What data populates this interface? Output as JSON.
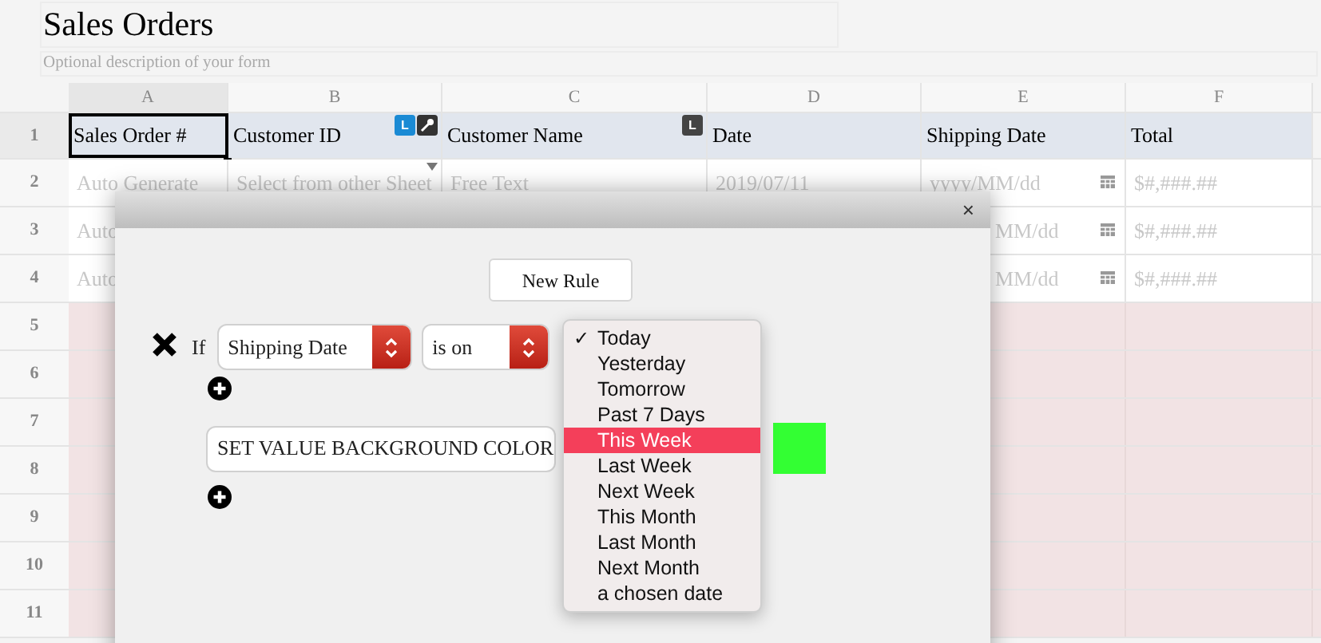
{
  "form": {
    "title": "Sales Orders",
    "description": "Optional description of your form"
  },
  "sheet": {
    "columns": [
      {
        "label": "A",
        "selected": true
      },
      {
        "label": "B",
        "selected": false
      },
      {
        "label": "C",
        "selected": false
      },
      {
        "label": "D",
        "selected": false
      },
      {
        "label": "E",
        "selected": false
      },
      {
        "label": "F",
        "selected": false
      }
    ],
    "rows": [
      {
        "number": "1",
        "kind": "header",
        "cells": [
          {
            "text": "Sales Order #",
            "selected": true
          },
          {
            "text": "Customer ID",
            "selected": false,
            "badges": [
              {
                "kind": "letter",
                "text": "L",
                "color": "#1a8ad4"
              },
              {
                "kind": "key",
                "color": "#333333"
              }
            ]
          },
          {
            "text": "Customer Name",
            "selected": false,
            "badges": [
              {
                "kind": "letter",
                "text": "L",
                "color": "#444444"
              }
            ]
          },
          {
            "text": "Date",
            "selected": false
          },
          {
            "text": "Shipping Date",
            "selected": false
          },
          {
            "text": "Total",
            "selected": false
          }
        ]
      },
      {
        "number": "2",
        "kind": "entry",
        "cells": [
          {
            "kind": "text",
            "text": "Auto Generate"
          },
          {
            "kind": "lookup",
            "text": "Select from other Sheet"
          },
          {
            "kind": "text",
            "text": "Free Text"
          },
          {
            "kind": "text",
            "text": "2019/07/11"
          },
          {
            "kind": "date",
            "text": "yyyy/MM/dd"
          },
          {
            "kind": "text",
            "text": "$#,###.##"
          }
        ]
      },
      {
        "number": "3",
        "kind": "entry",
        "cells": [
          {
            "kind": "text",
            "text": "Auto"
          },
          {
            "kind": "text"
          },
          {
            "kind": "text"
          },
          {
            "kind": "text"
          },
          {
            "kind": "date_cut",
            "text": "MM/dd"
          },
          {
            "kind": "text",
            "text": "$#,###.##"
          }
        ]
      },
      {
        "number": "4",
        "kind": "entry",
        "cells": [
          {
            "kind": "text",
            "text": "Auto"
          },
          {
            "kind": "text"
          },
          {
            "kind": "text"
          },
          {
            "kind": "text"
          },
          {
            "kind": "date_cut",
            "text": "MM/dd"
          },
          {
            "kind": "text",
            "text": "$#,###.##"
          }
        ]
      },
      {
        "number": "5",
        "kind": "blank"
      },
      {
        "number": "6",
        "kind": "blank"
      },
      {
        "number": "7",
        "kind": "blank"
      },
      {
        "number": "8",
        "kind": "blank"
      },
      {
        "number": "9",
        "kind": "blank"
      },
      {
        "number": "10",
        "kind": "blank"
      },
      {
        "number": "11",
        "kind": "blank"
      }
    ]
  },
  "dialog": {
    "close": "×",
    "new_rule_button": "New Rule",
    "rule": {
      "if_label": "If",
      "field": "Shipping Date",
      "operator": "is on",
      "value_menu": [
        {
          "label": "Today",
          "checked": true,
          "selected": false
        },
        {
          "label": "Yesterday",
          "checked": false,
          "selected": false
        },
        {
          "label": "Tomorrow",
          "checked": false,
          "selected": false
        },
        {
          "label": "Past 7 Days",
          "checked": false,
          "selected": false
        },
        {
          "label": "This Week",
          "checked": false,
          "selected": true
        },
        {
          "label": "Last Week",
          "checked": false,
          "selected": false
        },
        {
          "label": "Next Week",
          "checked": false,
          "selected": false
        },
        {
          "label": "This Month",
          "checked": false,
          "selected": false
        },
        {
          "label": "Last Month",
          "checked": false,
          "selected": false
        },
        {
          "label": "Next Month",
          "checked": false,
          "selected": false
        },
        {
          "label": "a chosen date",
          "checked": false,
          "selected": false
        }
      ],
      "check_mark": "✓",
      "action": "SET VALUE BACKGROUND COLOR"
    }
  }
}
